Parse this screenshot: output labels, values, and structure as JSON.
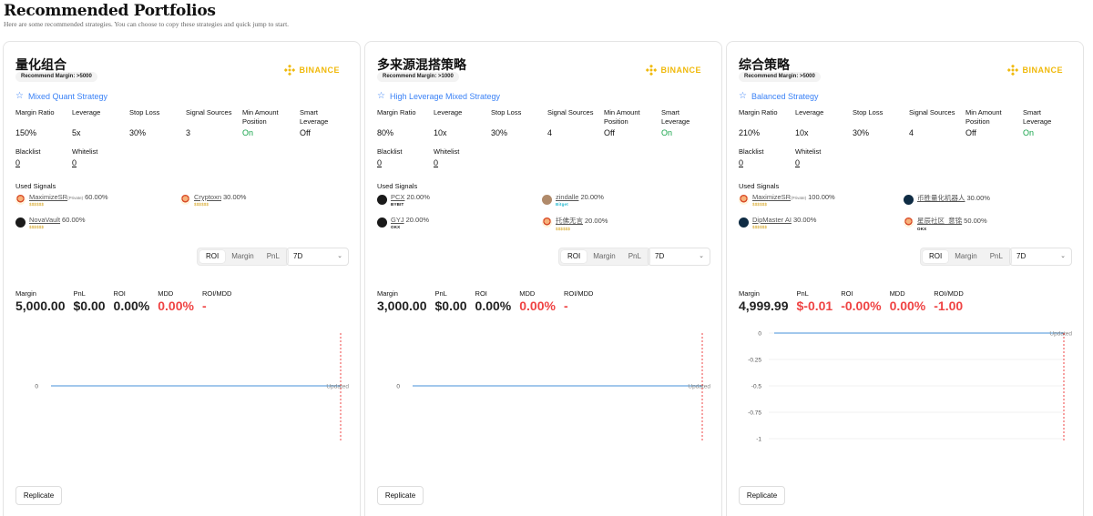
{
  "header": {
    "title": "Recommended Portfolios",
    "subtitle": "Here are some recommended strategies. You can choose to copy these strategies and quick jump to start."
  },
  "colors": {
    "accent_blue": "#3b82f6",
    "binance_yellow": "#f0b90b",
    "positive_green": "#16a34a",
    "negative_red": "#ef4444"
  },
  "labels": {
    "margin_ratio": "Margin Ratio",
    "leverage": "Leverage",
    "stop_loss": "Stop Loss",
    "signal_sources": "Signal Sources",
    "min_amount_position": "Min Amount Position",
    "smart_leverage": "Smart Leverage",
    "blacklist": "Blacklist",
    "whitelist": "Whitelist",
    "used_signals": "Used Signals",
    "seg_roi": "ROI",
    "seg_margin": "Margin",
    "seg_pnl": "PnL",
    "m_margin": "Margin",
    "m_pnl": "PnL",
    "m_roi": "ROI",
    "m_mdd": "MDD",
    "m_roimdd": "ROI/MDD",
    "replicate": "Replicate",
    "updated": "Updated",
    "exchange": "BINANCE"
  },
  "cards": [
    {
      "title": "量化组合",
      "recommend": "Recommend Margin: >5000",
      "strategy_type": "Mixed Quant Strategy",
      "margin_ratio": "150%",
      "leverage": "5x",
      "stop_loss": "30%",
      "signal_sources": "3",
      "min_amount": "On",
      "smart_leverage": "Off",
      "blacklist": "0",
      "whitelist": "0",
      "signals": [
        {
          "name": "MaximizeSR",
          "private": "(Private)",
          "pct": "60.00%",
          "sub": "$$$$$$",
          "avatar": "emoji"
        },
        {
          "name": "Cryptoxn",
          "private": "",
          "pct": "30.00%",
          "sub": "$$$$$$",
          "avatar": "emoji"
        },
        {
          "name": "NovaVault",
          "private": "",
          "pct": "60.00%",
          "sub": "$$$$$$",
          "avatar": "dark"
        }
      ],
      "period": "7D",
      "metrics": {
        "margin": "5,000.00",
        "pnl": "$0.00",
        "roi": "0.00%",
        "mdd": "0.00%",
        "roimdd": "-"
      },
      "yticks": [
        "0"
      ]
    },
    {
      "title": "多来源混搭策略",
      "recommend": "Recommend Margin: >1000",
      "strategy_type": "High Leverage Mixed Strategy",
      "margin_ratio": "80%",
      "leverage": "10x",
      "stop_loss": "30%",
      "signal_sources": "4",
      "min_amount": "Off",
      "smart_leverage": "On",
      "blacklist": "0",
      "whitelist": "0",
      "signals": [
        {
          "name": "PCX",
          "private": "",
          "pct": "20.00%",
          "sub": "BYBIT",
          "avatar": "dark"
        },
        {
          "name": "zindalle",
          "private": "",
          "pct": "20.00%",
          "sub": "Bitget",
          "avatar": "photo"
        },
        {
          "name": "GYJ",
          "private": "",
          "pct": "20.00%",
          "sub": "OKX",
          "avatar": "dark"
        },
        {
          "name": "托佛无言",
          "private": "",
          "pct": "20.00%",
          "sub": "$$$$$$",
          "avatar": "emoji"
        }
      ],
      "period": "7D",
      "metrics": {
        "margin": "3,000.00",
        "pnl": "$0.00",
        "roi": "0.00%",
        "mdd": "0.00%",
        "roimdd": "-"
      },
      "yticks": [
        "0"
      ]
    },
    {
      "title": "综合策略",
      "recommend": "Recommend Margin: >5000",
      "strategy_type": "Balanced Strategy",
      "margin_ratio": "210%",
      "leverage": "10x",
      "stop_loss": "30%",
      "signal_sources": "4",
      "min_amount": "Off",
      "smart_leverage": "On",
      "blacklist": "0",
      "whitelist": "0",
      "signals": [
        {
          "name": "MaximizeSR",
          "private": "(Private)",
          "pct": "100.00%",
          "sub": "$$$$$$",
          "avatar": "emoji"
        },
        {
          "name": "币胜量化机器人",
          "private": "",
          "pct": "30.00%",
          "sub": "",
          "avatar": "navy"
        },
        {
          "name": "DipMaster AI",
          "private": "",
          "pct": "30.00%",
          "sub": "$$$$$$",
          "avatar": "navy"
        },
        {
          "name": "星辰社区_意锦",
          "private": "",
          "pct": "50.00%",
          "sub": "OKX",
          "avatar": "emoji"
        }
      ],
      "period": "7D",
      "metrics": {
        "margin": "4,999.99",
        "pnl": "$-0.01",
        "roi": "-0.00%",
        "mdd": "0.00%",
        "roimdd": "-1.00"
      },
      "yticks": [
        "0",
        "-0.25",
        "-0.5",
        "-0.75",
        "-1"
      ]
    }
  ]
}
